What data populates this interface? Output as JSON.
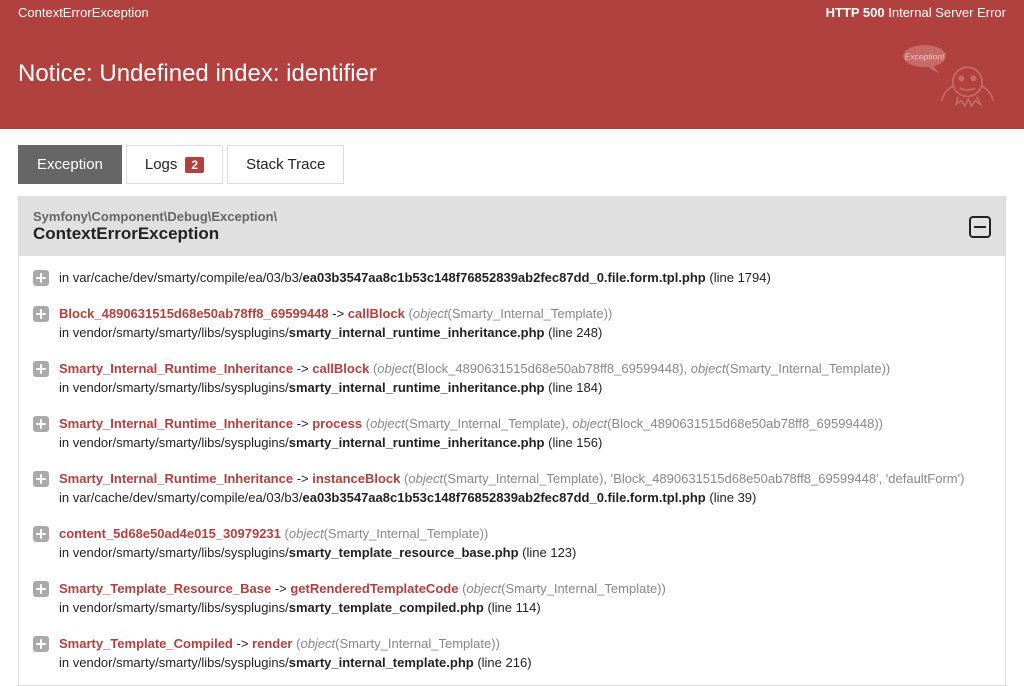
{
  "header": {
    "exception_short": "ContextErrorException",
    "http_label_code": "HTTP 500",
    "http_label_text": "Internal Server Error",
    "title": "Notice: Undefined index: identifier"
  },
  "tabs": {
    "exception": "Exception",
    "logs": "Logs",
    "logs_count": "2",
    "stack_trace": "Stack Trace"
  },
  "panel": {
    "namespace": "Symfony\\Component\\Debug\\Exception\\",
    "classname": "ContextErrorException"
  },
  "traces": [
    {
      "class": "",
      "method": "",
      "args": "",
      "in_prefix": "in var/cache/dev/smarty/compile/ea/03/b3/",
      "file_bold": "ea03b3547aa8c1b53c148f76852839ab2fec87dd_0.file.form.tpl.php",
      "line": "(line 1794)"
    },
    {
      "class": "Block_4890631515d68e50ab78ff8_69599448",
      "method": "callBlock",
      "args": "(object(Smarty_Internal_Template))",
      "in_prefix": "in vendor/smarty/smarty/libs/sysplugins/",
      "file_bold": "smarty_internal_runtime_inheritance.php",
      "line": "(line 248)"
    },
    {
      "class": "Smarty_Internal_Runtime_Inheritance",
      "method": "callBlock",
      "args": "(object(Block_4890631515d68e50ab78ff8_69599448), object(Smarty_Internal_Template))",
      "in_prefix": "in vendor/smarty/smarty/libs/sysplugins/",
      "file_bold": "smarty_internal_runtime_inheritance.php",
      "line": "(line 184)"
    },
    {
      "class": "Smarty_Internal_Runtime_Inheritance",
      "method": "process",
      "args": "(object(Smarty_Internal_Template), object(Block_4890631515d68e50ab78ff8_69599448))",
      "in_prefix": "in vendor/smarty/smarty/libs/sysplugins/",
      "file_bold": "smarty_internal_runtime_inheritance.php",
      "line": "(line 156)"
    },
    {
      "class": "Smarty_Internal_Runtime_Inheritance",
      "method": "instanceBlock",
      "args": "(object(Smarty_Internal_Template), 'Block_4890631515d68e50ab78ff8_69599448', 'defaultForm')",
      "in_prefix": "in var/cache/dev/smarty/compile/ea/03/b3/",
      "file_bold": "ea03b3547aa8c1b53c148f76852839ab2fec87dd_0.file.form.tpl.php",
      "line": "(line 39)"
    },
    {
      "class": "content_5d68e50ad4e015_30979231",
      "method": "",
      "args": "(object(Smarty_Internal_Template))",
      "in_prefix": "in vendor/smarty/smarty/libs/sysplugins/",
      "file_bold": "smarty_template_resource_base.php",
      "line": "(line 123)"
    },
    {
      "class": "Smarty_Template_Resource_Base",
      "method": "getRenderedTemplateCode",
      "args": "(object(Smarty_Internal_Template))",
      "in_prefix": "in vendor/smarty/smarty/libs/sysplugins/",
      "file_bold": "smarty_template_compiled.php",
      "line": "(line 114)"
    },
    {
      "class": "Smarty_Template_Compiled",
      "method": "render",
      "args": "(object(Smarty_Internal_Template))",
      "in_prefix": "in vendor/smarty/smarty/libs/sysplugins/",
      "file_bold": "smarty_internal_template.php",
      "line": "(line 216)"
    }
  ]
}
